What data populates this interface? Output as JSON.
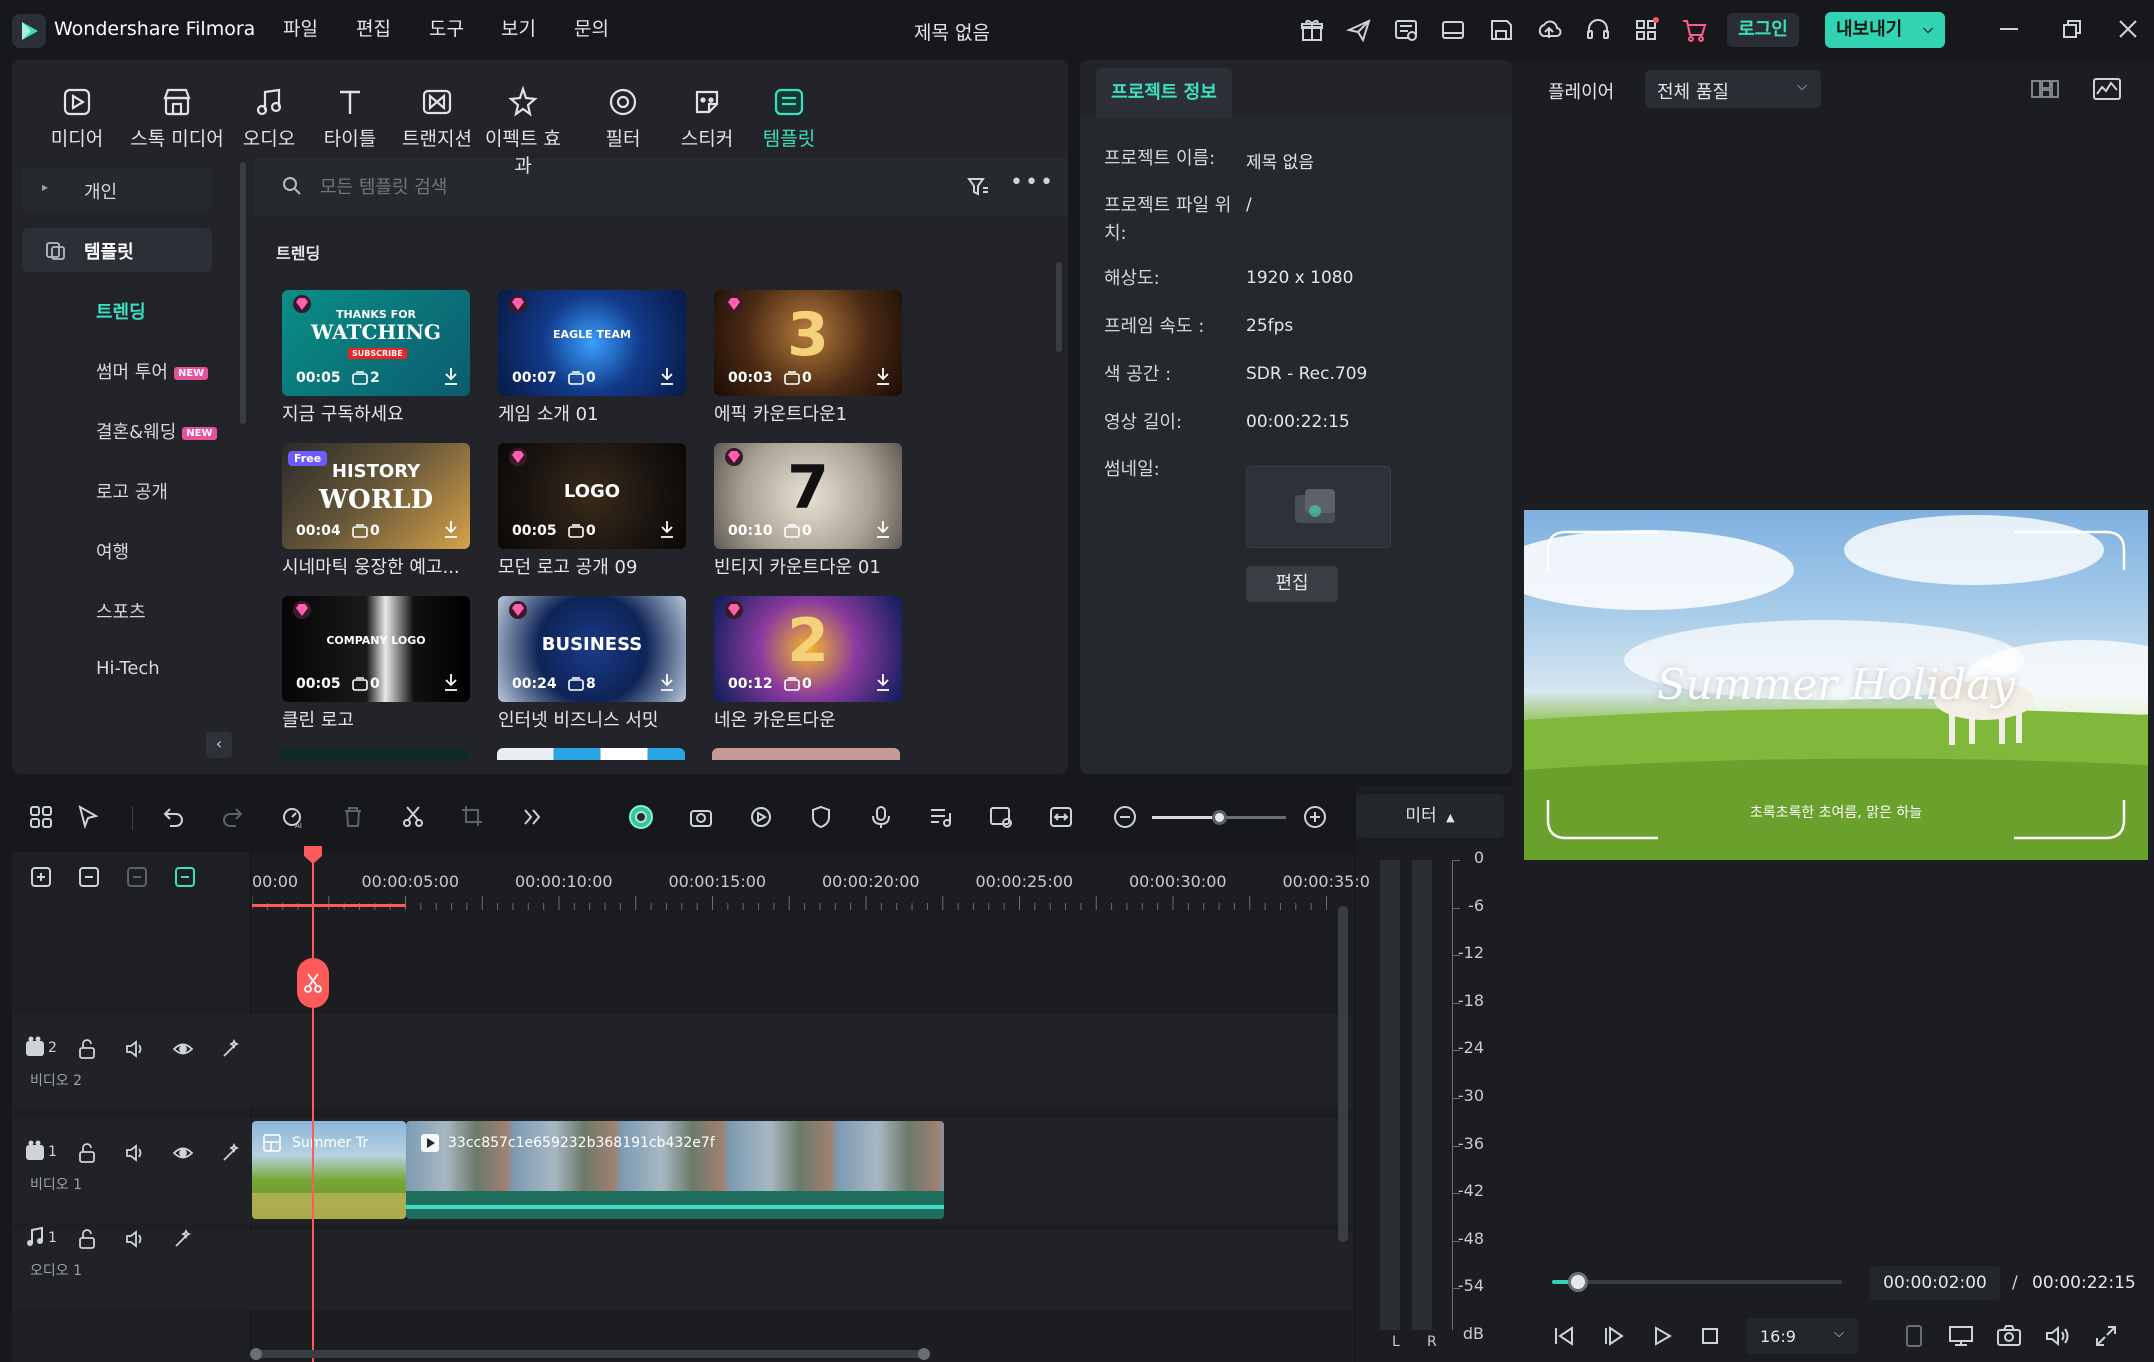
{
  "app": {
    "name": "Wondershare Filmora",
    "document_title": "제목 없음"
  },
  "menu": [
    "파일",
    "편집",
    "도구",
    "보기",
    "문의"
  ],
  "titlebar": {
    "login_label": "로그인",
    "export_label": "내보내기"
  },
  "media_tabs": [
    {
      "label": "미디어",
      "icon": "media-icon"
    },
    {
      "label": "스톡 미디어",
      "icon": "stock-media-icon"
    },
    {
      "label": "오디오",
      "icon": "audio-icon"
    },
    {
      "label": "타이틀",
      "icon": "title-icon"
    },
    {
      "label": "트랜지션",
      "icon": "transition-icon"
    },
    {
      "label": "이펙트 효과",
      "icon": "effects-icon"
    },
    {
      "label": "필터",
      "icon": "filter-icon"
    },
    {
      "label": "스티커",
      "icon": "sticker-icon"
    },
    {
      "label": "템플릿",
      "icon": "template-icon"
    }
  ],
  "sidebar": {
    "personal": "개인",
    "templates": "템플릿",
    "categories": [
      {
        "label": "트렌딩",
        "new": ""
      },
      {
        "label": "썸머 투어",
        "new": "NEW"
      },
      {
        "label": "결혼&웨딩",
        "new": "NEW"
      },
      {
        "label": "로고 공개",
        "new": ""
      },
      {
        "label": "여행",
        "new": ""
      },
      {
        "label": "스포츠",
        "new": ""
      },
      {
        "label": "Hi-Tech",
        "new": ""
      }
    ]
  },
  "search": {
    "placeholder": "모든 템플릿 검색"
  },
  "section_title": "트렌딩",
  "templates": [
    {
      "title": "지금 구독하세요",
      "duration": "00:05",
      "count": "2",
      "overlay": "THANKS FOR",
      "overlay2": "WATCHING",
      "overlay3": "SUBSCRIBE"
    },
    {
      "title": "게임 소개 01",
      "duration": "00:07",
      "count": "0",
      "overlay": "EAGLE TEAM",
      "overlay2": "",
      "overlay3": ""
    },
    {
      "title": "에픽 카운트다운1",
      "duration": "00:03",
      "count": "0",
      "overlay": "3",
      "overlay2": "",
      "overlay3": ""
    },
    {
      "title": "시네마틱 웅장한 예고...",
      "duration": "00:04",
      "count": "0",
      "overlay": "HISTORY",
      "overlay2": "WORLD",
      "overlay3": "Free"
    },
    {
      "title": "모던 로고 공개 09",
      "duration": "00:05",
      "count": "0",
      "overlay": "LOGO",
      "overlay2": "",
      "overlay3": ""
    },
    {
      "title": "빈티지 카운트다운 01",
      "duration": "00:10",
      "count": "0",
      "overlay": "7",
      "overlay2": "",
      "overlay3": ""
    },
    {
      "title": "클린 로고",
      "duration": "00:05",
      "count": "0",
      "overlay": "COMPANY LOGO",
      "overlay2": "",
      "overlay3": ""
    },
    {
      "title": "인터넷 비즈니스 서밋",
      "duration": "00:24",
      "count": "8",
      "overlay": "BUSINESS",
      "overlay2": "",
      "overlay3": ""
    },
    {
      "title": "네온 카운트다운",
      "duration": "00:12",
      "count": "0",
      "overlay": "2",
      "overlay2": "",
      "overlay3": ""
    }
  ],
  "project_info": {
    "tab": "프로젝트 정보",
    "rows": [
      {
        "label": "프로젝트 이름:",
        "value": "제목 없음"
      },
      {
        "label": "프로젝트 파일 위치:",
        "value": "/"
      },
      {
        "label": "해상도:",
        "value": "1920 x 1080"
      },
      {
        "label": "프레임 속도 :",
        "value": "25fps"
      },
      {
        "label": "색 공간 :",
        "value": "SDR - Rec.709"
      },
      {
        "label": "영상 길이:",
        "value": "00:00:22:15"
      }
    ],
    "thumbnail_label": "썸네일:",
    "edit_label": "편집"
  },
  "player": {
    "label": "플레이어",
    "quality": "전체 품질",
    "preview_title": "Summer Holiday",
    "preview_subtitle": "초록초록한 초여름, 맑은 하늘",
    "current_time": "00:00:02:00",
    "separator": "/",
    "total_time": "00:00:22:15",
    "aspect": "16:9",
    "progress": 0.09
  },
  "timeline": {
    "ruler": [
      "00:00",
      "00:00:05:00",
      "00:00:10:00",
      "00:00:15:00",
      "00:00:20:00",
      "00:00:25:00",
      "00:00:30:00",
      "00:00:35:0"
    ],
    "tracks": [
      {
        "name": "비디오 2",
        "num": "2"
      },
      {
        "name": "비디오 1",
        "num": "1"
      },
      {
        "name": "오디오 1",
        "num": "1"
      }
    ],
    "clip1_label": "Summer Tr",
    "clip2_label": "33cc857c1e659232b368191cb432e7f"
  },
  "meter": {
    "title": "미터",
    "scale": [
      "0",
      "-6",
      "-12",
      "-18",
      "-24",
      "-30",
      "-36",
      "-42",
      "-48",
      "-54",
      "dB"
    ],
    "channels": [
      "L",
      "R"
    ]
  },
  "colors": {
    "accent": "#31d3b3",
    "brand": "#3be0c0",
    "playhead": "#ff5a5a"
  }
}
